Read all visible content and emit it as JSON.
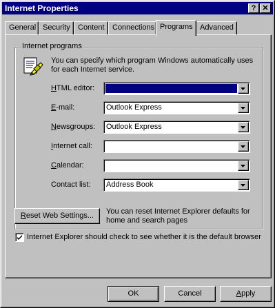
{
  "window": {
    "title": "Internet Properties",
    "help_btn": "?",
    "close_btn": "✕"
  },
  "tabs": [
    {
      "label": "General"
    },
    {
      "label": "Security"
    },
    {
      "label": "Content"
    },
    {
      "label": "Connections"
    },
    {
      "label": "Programs"
    },
    {
      "label": "Advanced"
    }
  ],
  "active_tab": "Programs",
  "programs": {
    "group_label": "Internet programs",
    "description": "You can specify which program Windows automatically uses for each Internet service.",
    "fields": [
      {
        "label_first": "H",
        "label_rest": "TML editor:",
        "value": ""
      },
      {
        "label_first": "E",
        "label_rest": "-mail:",
        "value": "Outlook Express"
      },
      {
        "label_first": "N",
        "label_rest": "ewsgroups:",
        "value": "Outlook Express"
      },
      {
        "label_first": "I",
        "label_rest": "nternet call:",
        "value": ""
      },
      {
        "label_first": "C",
        "label_rest": "alendar:",
        "value": ""
      },
      {
        "label_first": "",
        "label_rest": "Contact list:",
        "value": "Address Book"
      }
    ]
  },
  "reset": {
    "button_first": "R",
    "button_rest": "eset Web Settings...",
    "note": "You can reset Internet Explorer defaults for home and search pages"
  },
  "default_check": {
    "checked": true,
    "label": "Internet Explorer should check to see whether it is the default browser"
  },
  "buttons": {
    "ok": "OK",
    "cancel": "Cancel",
    "apply_first": "A",
    "apply_rest": "pply"
  },
  "colors": {
    "titlebar": "#000080",
    "face": "#c0c0c0",
    "selection": "#000080"
  }
}
